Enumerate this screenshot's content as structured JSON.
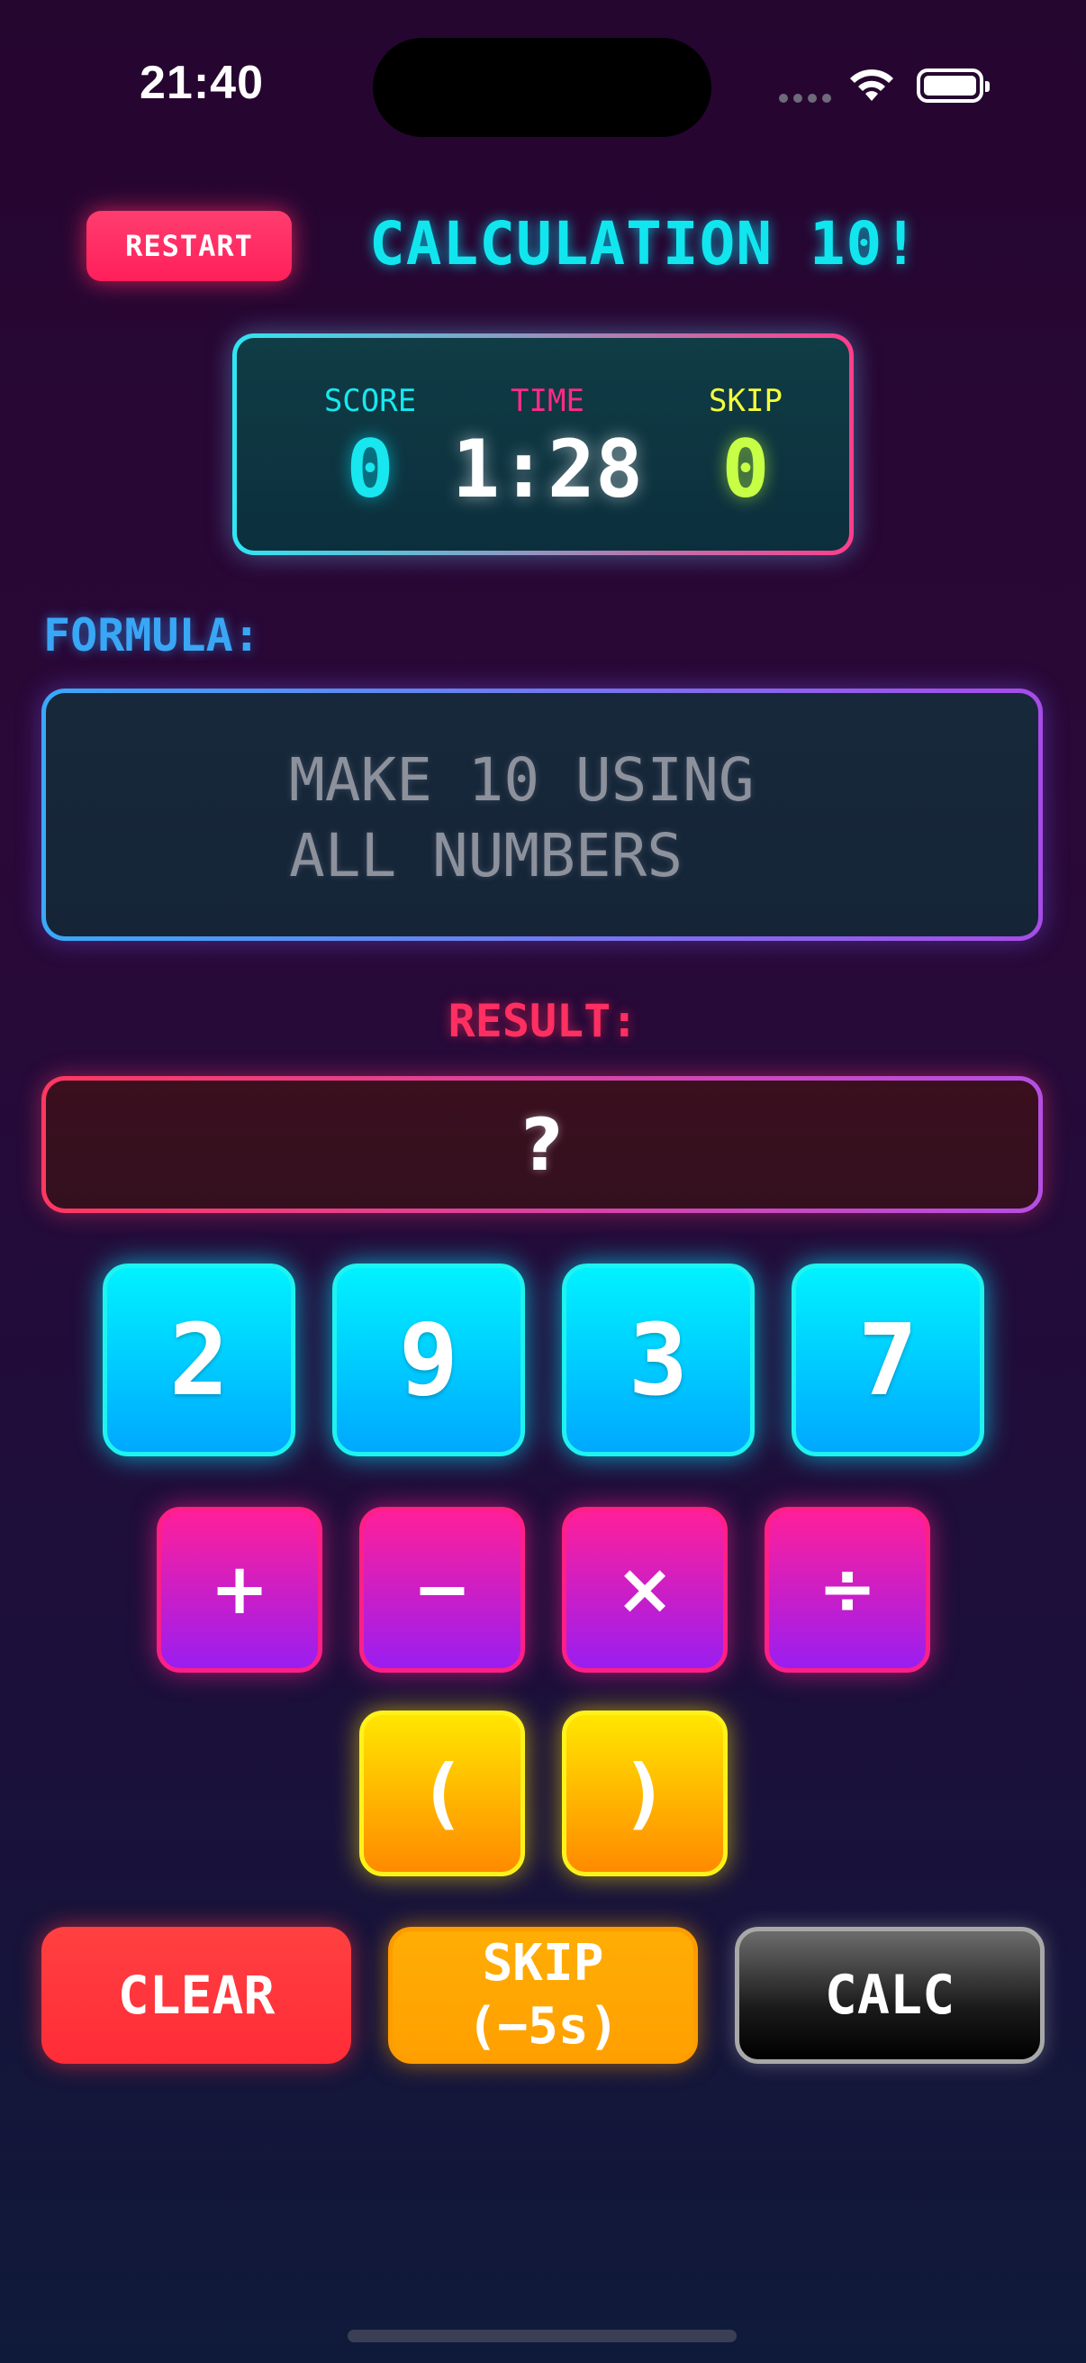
{
  "status_bar": {
    "time": "21:40"
  },
  "header": {
    "restart_label": "RESTART",
    "title": "CALCULATION 10!"
  },
  "scoreboard": {
    "score_label": "SCORE",
    "score_value": "0",
    "time_label": "TIME",
    "time_value": "1:28",
    "skip_label": "SKIP",
    "skip_value": "0"
  },
  "formula": {
    "label": "FORMULA:",
    "placeholder_line1": "MAKE 10 USING",
    "placeholder_line2": "ALL NUMBERS"
  },
  "result": {
    "label": "RESULT:",
    "value": "?"
  },
  "numbers": [
    "2",
    "9",
    "3",
    "7"
  ],
  "operators": [
    "+",
    "−",
    "×",
    "÷"
  ],
  "parens": [
    "(",
    ")"
  ],
  "actions": {
    "clear_label": "CLEAR",
    "skip_line1": "SKIP",
    "skip_line2": "(−5s)",
    "calc_label": "CALC"
  },
  "colors": {
    "background_top": "#25062f",
    "background_bottom": "#0f1a3a",
    "accent_cyan": "#11e6ee",
    "accent_pink": "#ff2b86",
    "accent_yellow": "#ffe600",
    "result_red": "#ff2f62"
  },
  "icons": [
    "cellular-signal-icon",
    "wifi-icon",
    "battery-icon"
  ]
}
